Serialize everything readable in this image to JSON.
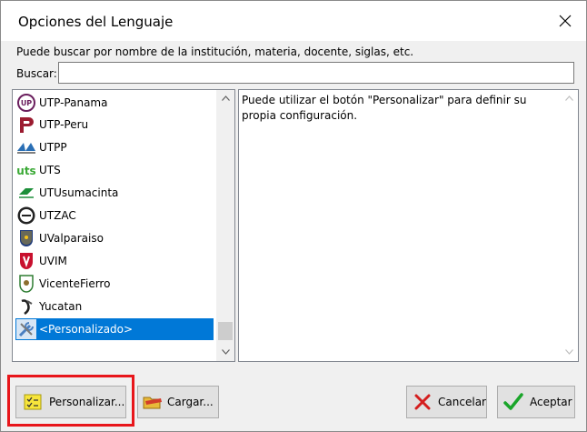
{
  "window": {
    "title": "Opciones del Lenguaje"
  },
  "hint": "Puede buscar por nombre de la institución, materia, docente, siglas, etc.",
  "search": {
    "label": "Buscar:",
    "value": "",
    "placeholder": ""
  },
  "list": {
    "items": [
      {
        "label": "UTP-Panama",
        "icon": "utp-panama-logo-icon"
      },
      {
        "label": "UTP-Peru",
        "icon": "utp-peru-logo-icon"
      },
      {
        "label": "UTPP",
        "icon": "utpp-logo-icon"
      },
      {
        "label": "UTS",
        "icon": "uts-logo-icon"
      },
      {
        "label": "UTUsumacinta",
        "icon": "utusumacinta-logo-icon"
      },
      {
        "label": "UTZAC",
        "icon": "utzac-logo-icon"
      },
      {
        "label": "UValparaiso",
        "icon": "uvalparaiso-logo-icon"
      },
      {
        "label": "UVIM",
        "icon": "uvim-logo-icon"
      },
      {
        "label": "VicenteFierro",
        "icon": "vicentefierro-logo-icon"
      },
      {
        "label": "Yucatan",
        "icon": "yucatan-logo-icon"
      },
      {
        "label": "<Personalizado>",
        "icon": "tools-icon",
        "selected": true
      }
    ]
  },
  "description": "Puede utilizar el botón \"Personalizar\" para definir su propia configuración.",
  "buttons": {
    "personalizar": "Personalizar...",
    "cargar": "Cargar...",
    "cancelar": "Cancelar",
    "aceptar": "Aceptar"
  },
  "colors": {
    "selection": "#0078d7",
    "highlight_box": "#e8161b",
    "accept_check": "#1aa52a",
    "cancel_x": "#d41e1e"
  }
}
